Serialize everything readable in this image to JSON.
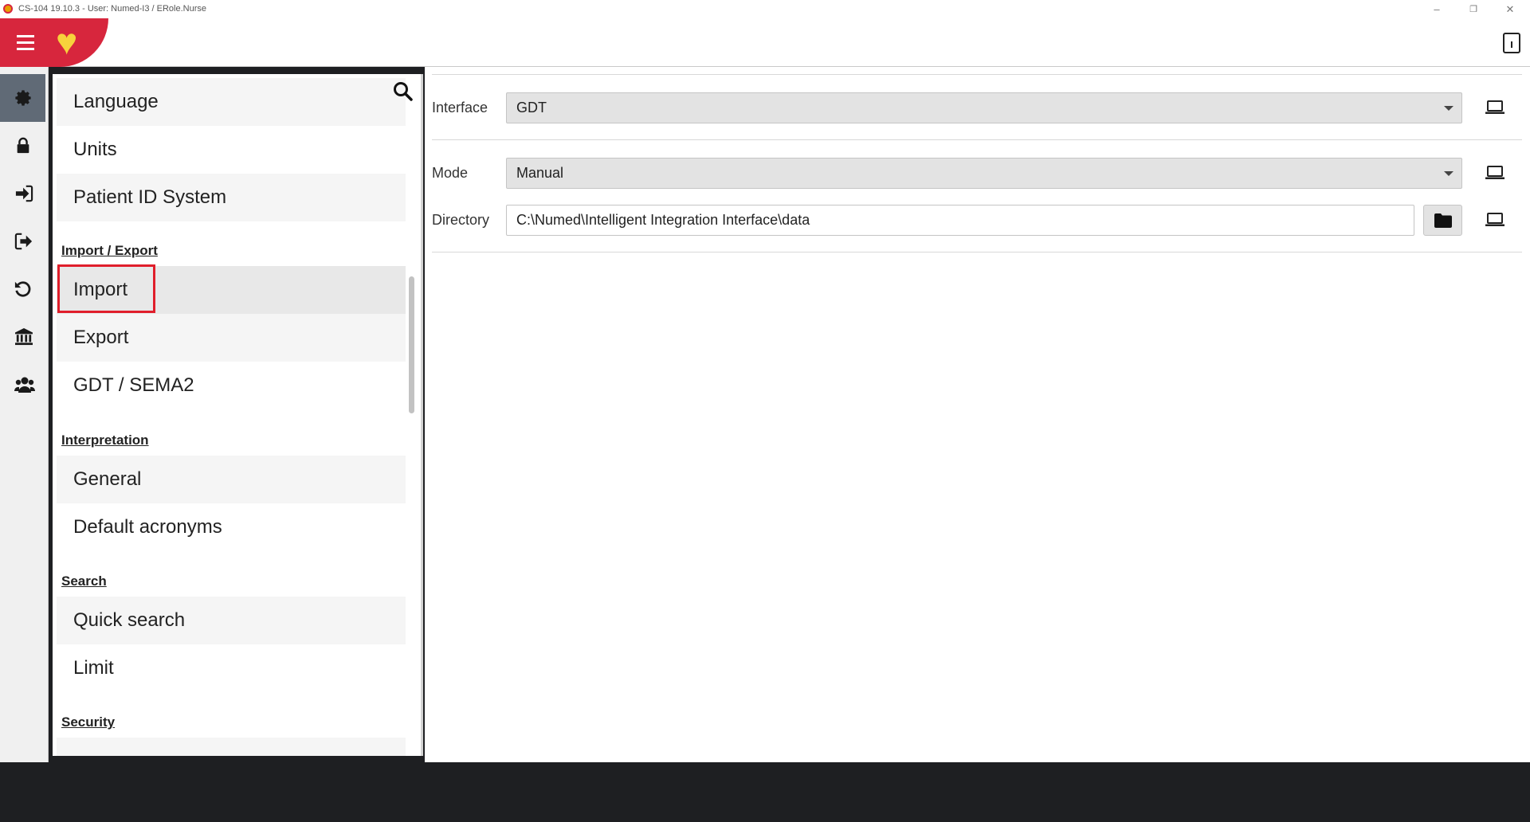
{
  "window": {
    "title": "CS-104 19.10.3 - User: Numed-I3 / ERole.Nurse",
    "minimize": "–",
    "restore": "❐",
    "close": "✕"
  },
  "colors": {
    "brand_red": "#d7263d",
    "heart_yellow": "#f7d23c",
    "highlight_red": "#e01e2b"
  },
  "header": {
    "logo_icon": "heart-logo",
    "heart_glyph": "♥"
  },
  "leftbar": {
    "items": [
      {
        "icon": "gear-icon",
        "active": true
      },
      {
        "icon": "lock-icon",
        "active": false
      },
      {
        "icon": "sign-in-icon",
        "active": false
      },
      {
        "icon": "sign-out-icon",
        "active": false
      },
      {
        "icon": "undo-icon",
        "active": false
      },
      {
        "icon": "institution-icon",
        "active": false
      },
      {
        "icon": "users-icon",
        "active": false
      }
    ]
  },
  "nav": {
    "items": [
      {
        "label": "Language"
      },
      {
        "label": "Units"
      },
      {
        "label": "Patient ID System"
      }
    ],
    "sections": [
      {
        "header": "Import / Export",
        "items": [
          {
            "label": "Import",
            "selected": true
          },
          {
            "label": "Export"
          },
          {
            "label": "GDT / SEMA2"
          }
        ]
      },
      {
        "header": "Interpretation",
        "items": [
          {
            "label": "General"
          },
          {
            "label": "Default acronyms"
          }
        ]
      },
      {
        "header": "Search",
        "items": [
          {
            "label": "Quick search"
          },
          {
            "label": "Limit"
          }
        ]
      },
      {
        "header": "Security",
        "items": []
      }
    ]
  },
  "main": {
    "interface": {
      "label": "Interface",
      "value": "GDT"
    },
    "mode": {
      "label": "Mode",
      "value": "Manual"
    },
    "directory": {
      "label": "Directory",
      "value": "C:\\Numed\\Intelligent Integration Interface\\data"
    }
  }
}
